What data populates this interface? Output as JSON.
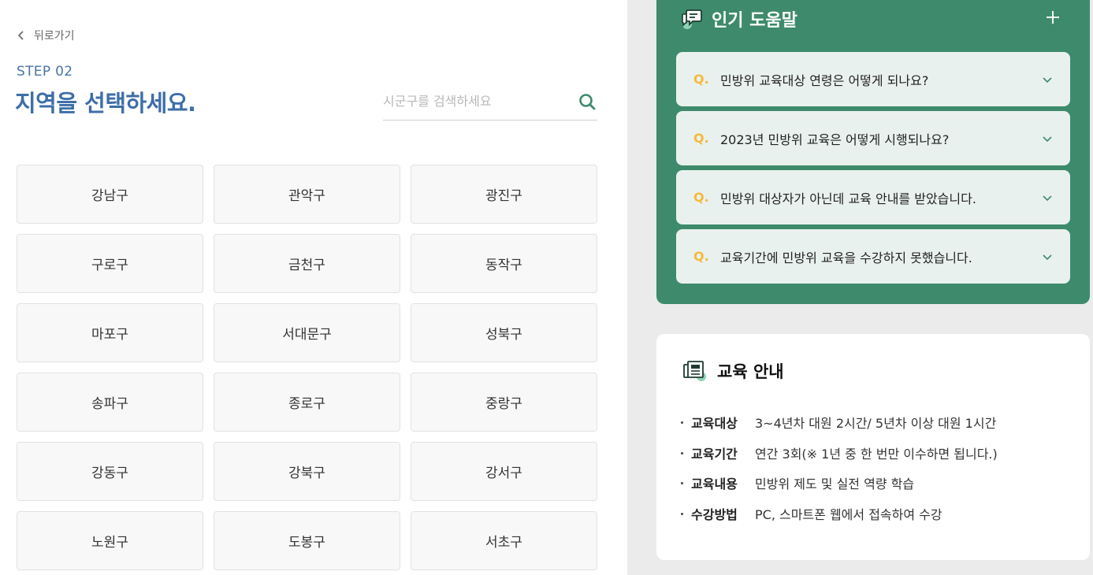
{
  "header": {
    "back_label": "뒤로가기",
    "step": "STEP 02",
    "title": "지역을 선택하세요."
  },
  "search": {
    "placeholder": "시군구를 검색하세요",
    "value": "",
    "icon": "search-icon"
  },
  "districts": [
    "강남구",
    "관악구",
    "광진구",
    "구로구",
    "금천구",
    "동작구",
    "마포구",
    "서대문구",
    "성북구",
    "송파구",
    "종로구",
    "중랑구",
    "강동구",
    "강북구",
    "강서구",
    "노원구",
    "도봉구",
    "서초구"
  ],
  "faq": {
    "title": "인기 도움말",
    "icon": "chat-bubble-icon",
    "q_mark": "Q.",
    "items": [
      "민방위 교육대상 연령은 어떻게 되나요?",
      "2023년 민방위 교육은 어떻게 시행되나요?",
      "민방위 대상자가 아닌데 교육 안내를 받았습니다.",
      "교육기간에 민방위 교육을 수강하지 못했습니다."
    ]
  },
  "edu": {
    "title": "교육 안내",
    "icon": "newspaper-icon",
    "rows": [
      {
        "label": "교육대상",
        "value": "3~4년차 대원 2시간/ 5년차 이상 대원 1시간"
      },
      {
        "label": "교육기간",
        "value": "연간 3회(※ 1년 중 한 번만 이수하면 됩니다.)"
      },
      {
        "label": "교육내용",
        "value": "민방위 제도 및 실전 역량 학습"
      },
      {
        "label": "수강방법",
        "value": "PC, 스마트폰 웹에서 접속하여 수강"
      }
    ]
  },
  "colors": {
    "accent_blue": "#3f6ea8",
    "panel_green": "#3d8b6c",
    "q_yellow": "#f5b93c",
    "search_icon_green": "#3d8b6c"
  }
}
